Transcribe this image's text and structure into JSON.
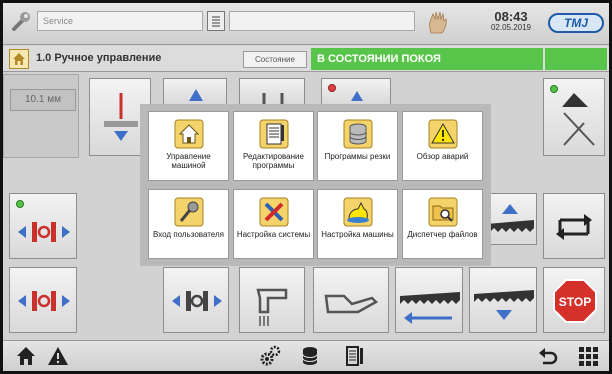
{
  "topbar": {
    "user_field": "Service",
    "message_field": "",
    "time": "08:43",
    "date": "02.05.2019",
    "logo": "TMJ"
  },
  "status": {
    "mode_title": "1.0 Ручное управление",
    "state_label": "Состояние",
    "state_value": "В СОСТОЯНИИ ПОКОЯ",
    "state_color": "#59c44a"
  },
  "machine": {
    "feed_value": "10.1 мм",
    "stop_label": "STOP",
    "stop_color": "#d6302a"
  },
  "menu": {
    "items": [
      {
        "label": "Управление машиной",
        "icon": "home-icon"
      },
      {
        "label": "Редактирование программы",
        "icon": "document-icon"
      },
      {
        "label": "Программы резки",
        "icon": "database-icon"
      },
      {
        "label": "Обзор аварий",
        "icon": "warning-icon"
      },
      {
        "label": "Вход пользователя",
        "icon": "key-icon"
      },
      {
        "label": "Настройка системы",
        "icon": "tools-icon"
      },
      {
        "label": "Настройка машины",
        "icon": "oil-can-icon"
      },
      {
        "label": "Диспетчер файлов",
        "icon": "folder-search-icon"
      }
    ]
  },
  "bottombar": {
    "left_icons": [
      "home-icon",
      "warning-icon"
    ],
    "center_icons": [
      "gears-icon",
      "database-icon",
      "document-icon"
    ],
    "right_icons": [
      "back-icon",
      "grid-icon"
    ]
  }
}
